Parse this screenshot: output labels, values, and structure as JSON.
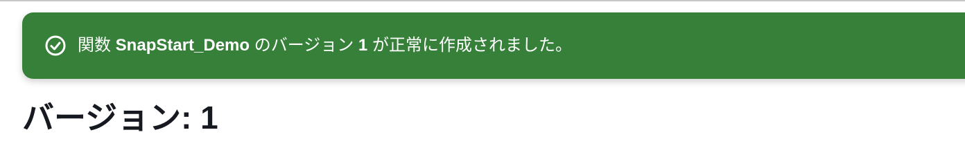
{
  "flash": {
    "message_prefix": "関数 ",
    "function_name": "SnapStart_Demo",
    "message_middle": " のバージョン ",
    "version_number": "1",
    "message_suffix": " が正常に作成されました。",
    "icon": "check-circle-icon",
    "background_color": "#37803a"
  },
  "page": {
    "title": "バージョン: 1"
  }
}
